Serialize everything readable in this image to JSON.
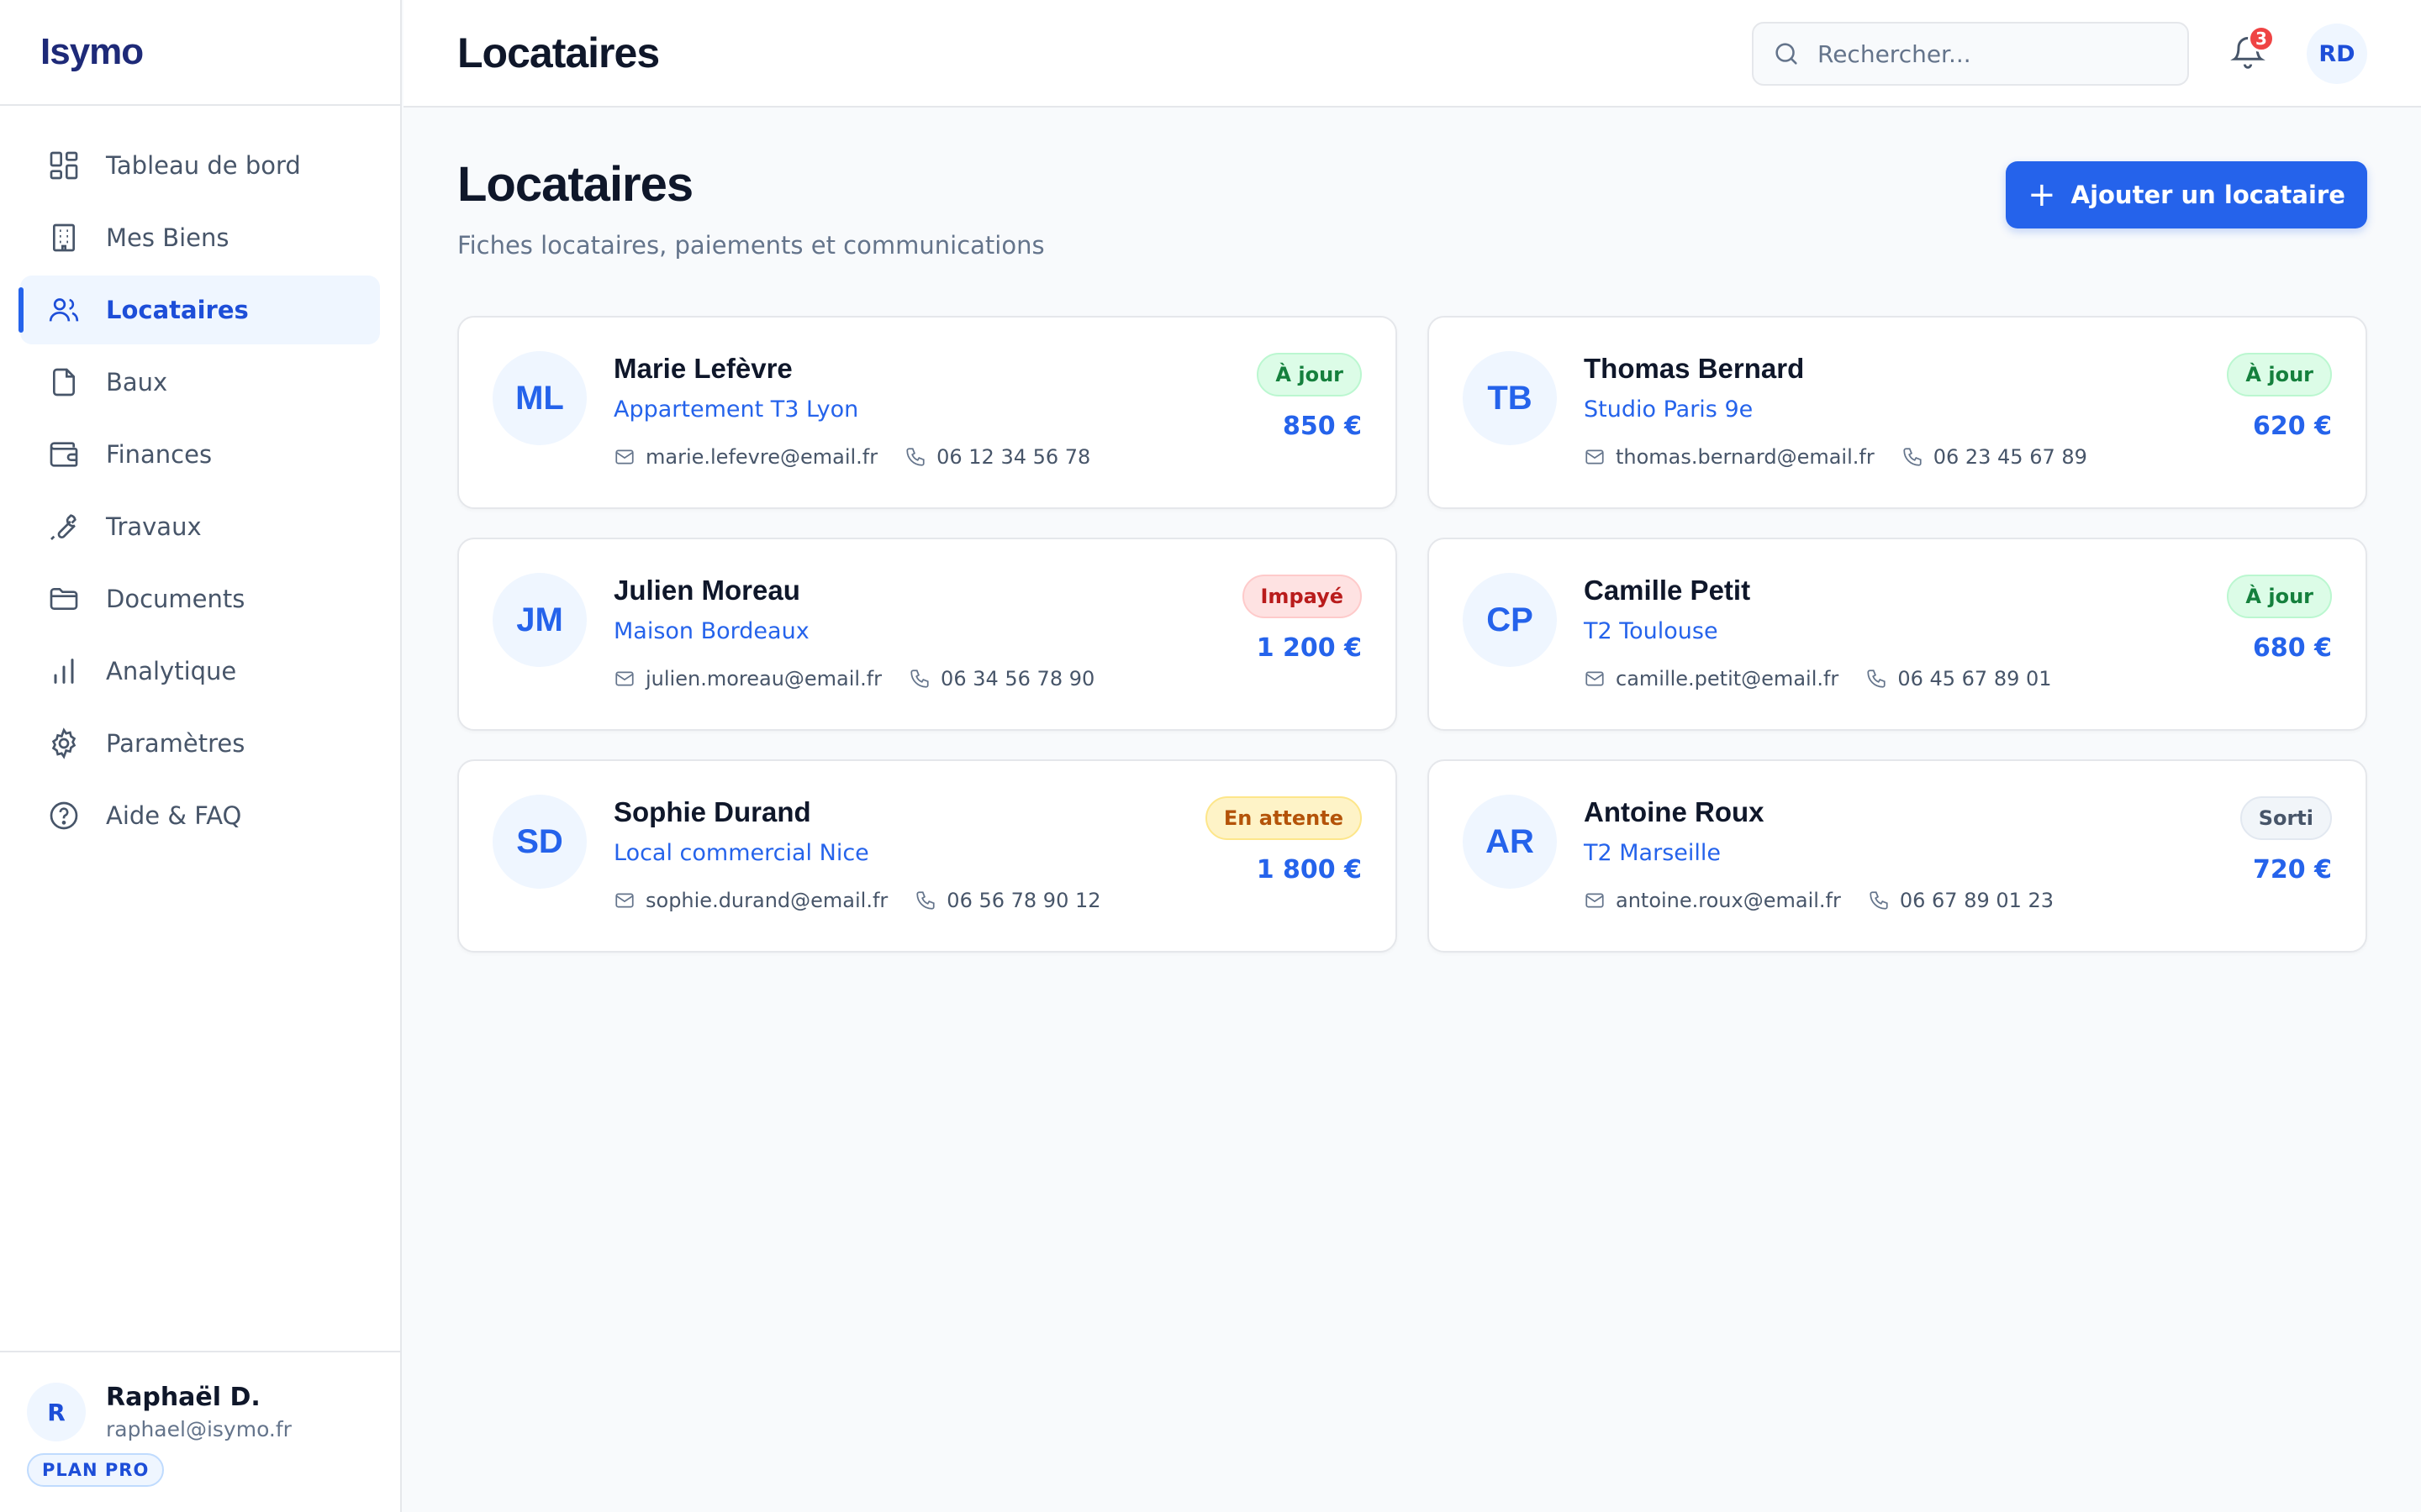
{
  "app": {
    "name": "Isymo"
  },
  "sidebar": {
    "items": [
      {
        "label": "Tableau de bord",
        "icon": "dashboard-icon"
      },
      {
        "label": "Mes Biens",
        "icon": "building-icon"
      },
      {
        "label": "Locataires",
        "icon": "users-icon",
        "active": true
      },
      {
        "label": "Baux",
        "icon": "file-icon"
      },
      {
        "label": "Finances",
        "icon": "wallet-icon"
      },
      {
        "label": "Travaux",
        "icon": "wrench-icon"
      },
      {
        "label": "Documents",
        "icon": "folder-icon"
      },
      {
        "label": "Analytique",
        "icon": "bar-chart-icon"
      },
      {
        "label": "Paramètres",
        "icon": "gear-icon"
      },
      {
        "label": "Aide & FAQ",
        "icon": "help-icon"
      }
    ],
    "user": {
      "initial": "R",
      "name": "Raphaël D.",
      "email": "raphael@isymo.fr",
      "plan": "PLAN PRO"
    }
  },
  "topbar": {
    "title": "Locataires",
    "search_placeholder": "Rechercher...",
    "notification_count": "3",
    "avatar_initials": "RD"
  },
  "page": {
    "title": "Locataires",
    "subtitle": "Fiches locataires, paiements et communications",
    "add_button_label": "Ajouter un locataire"
  },
  "status_colors": {
    "a_jour": "#15803d",
    "impaye": "#b91c1c",
    "en_attente": "#b45309",
    "sorti": "#475569",
    "accent": "#2563eb"
  },
  "tenants": [
    {
      "initials": "ML",
      "name": "Marie Lefèvre",
      "property": "Appartement T3 Lyon",
      "email": "marie.lefevre@email.fr",
      "phone": "06 12 34 56 78",
      "status": "À jour",
      "status_kind": "green",
      "rent": "850 €"
    },
    {
      "initials": "TB",
      "name": "Thomas Bernard",
      "property": "Studio Paris 9e",
      "email": "thomas.bernard@email.fr",
      "phone": "06 23 45 67 89",
      "status": "À jour",
      "status_kind": "green",
      "rent": "620 €"
    },
    {
      "initials": "JM",
      "name": "Julien Moreau",
      "property": "Maison Bordeaux",
      "email": "julien.moreau@email.fr",
      "phone": "06 34 56 78 90",
      "status": "Impayé",
      "status_kind": "red",
      "rent": "1 200 €"
    },
    {
      "initials": "CP",
      "name": "Camille Petit",
      "property": "T2 Toulouse",
      "email": "camille.petit@email.fr",
      "phone": "06 45 67 89 01",
      "status": "À jour",
      "status_kind": "green",
      "rent": "680 €"
    },
    {
      "initials": "SD",
      "name": "Sophie Durand",
      "property": "Local commercial Nice",
      "email": "sophie.durand@email.fr",
      "phone": "06 56 78 90 12",
      "status": "En attente",
      "status_kind": "amber",
      "rent": "1 800 €"
    },
    {
      "initials": "AR",
      "name": "Antoine Roux",
      "property": "T2 Marseille",
      "email": "antoine.roux@email.fr",
      "phone": "06 67 89 01 23",
      "status": "Sorti",
      "status_kind": "gray",
      "rent": "720 €"
    }
  ]
}
